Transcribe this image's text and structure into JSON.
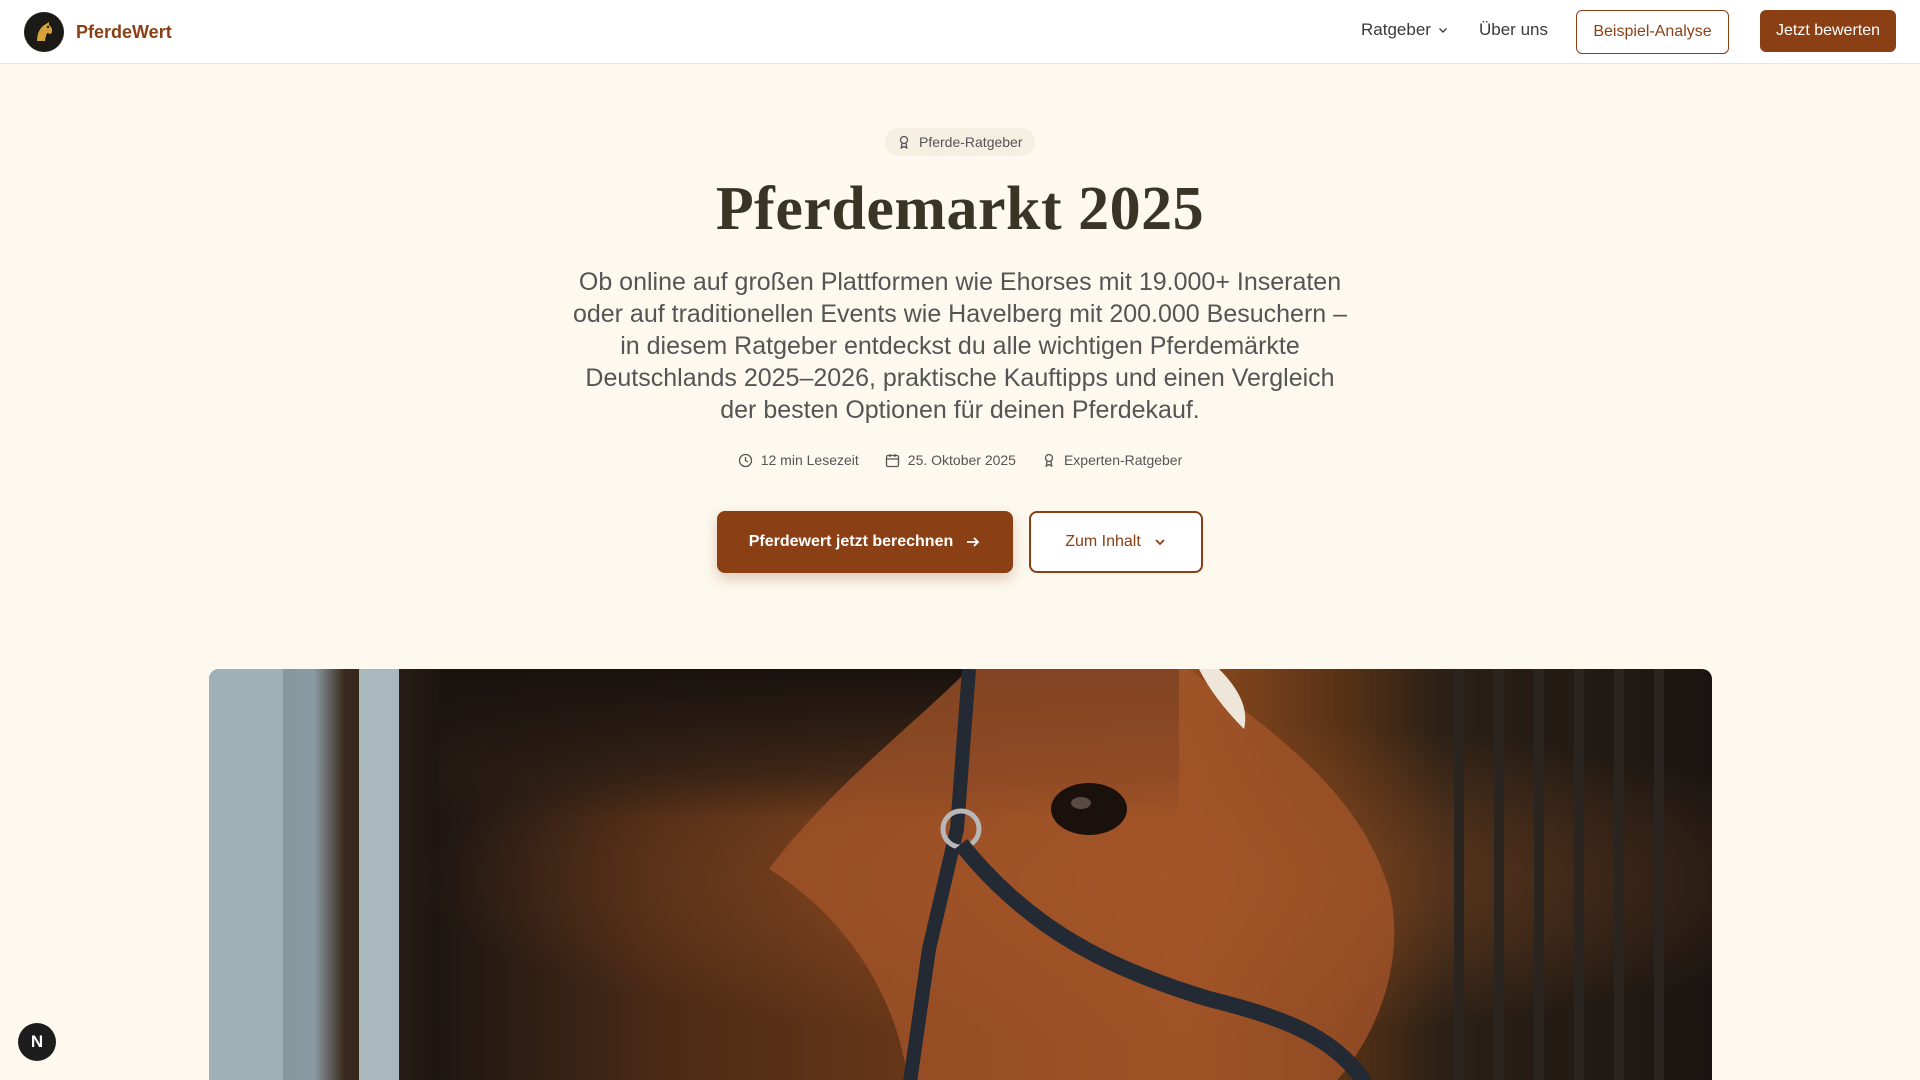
{
  "header": {
    "brand_name": "PferdeWert",
    "nav": {
      "ratgeber_label": "Ratgeber",
      "about_label": "Über uns"
    },
    "sample_button_label": "Beispiel-Analyse",
    "cta_button_label": "Jetzt bewerten"
  },
  "hero": {
    "badge_label": "Pferde-Ratgeber",
    "title": "Pferdemarkt 2025",
    "intro": "Ob online auf großen Plattformen wie Ehorses mit 19.000+ Inseraten oder auf traditionellen Events wie Havelberg mit 200.000 Besuchern – in diesem Ratgeber entdeckst du alle wichtigen Pferdemärkte Deutschlands 2025–2026, praktische Kauftipps und einen Vergleich der besten Optionen für deinen Pferdekauf.",
    "meta": {
      "reading_time": "12 min Lesezeit",
      "date": "25. Oktober 2025",
      "category": "Experten-Ratgeber"
    },
    "primary_button_label": "Pferdewert jetzt berechnen",
    "secondary_button_label": "Zum Inhalt"
  },
  "floating_badge_label": "N",
  "colors": {
    "brand": "#8b3f14",
    "background": "#fdf9ee",
    "title": "#3a3426"
  },
  "icons": {
    "logo": "horse-head-logo-icon",
    "ratgeber_chevron": "chevron-down-icon",
    "badge": "award-icon",
    "reading_time": "clock-icon",
    "date": "calendar-icon",
    "category": "award-icon",
    "primary_button": "arrow-right-icon",
    "secondary_button": "chevron-down-icon"
  }
}
